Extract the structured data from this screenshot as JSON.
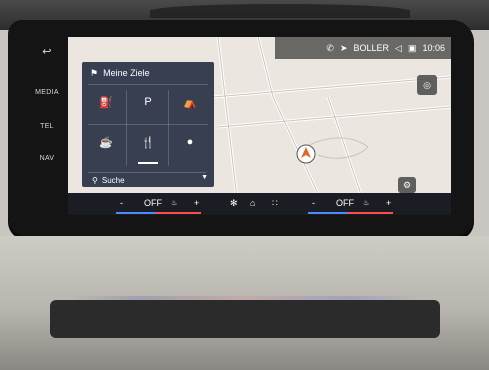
{
  "side_buttons": {
    "media": "MEDIA",
    "tel": "TEL",
    "nav": "NAV"
  },
  "status": {
    "location": "BOLLER",
    "time": "10:06"
  },
  "ziele": {
    "title": "Meine Ziele",
    "search": "Suche",
    "tiles": [
      "fuel-pump-icon",
      "parking-icon",
      "picnic-icon",
      "coffee-icon",
      "restaurant-icon",
      "burger-icon"
    ]
  },
  "climate": {
    "left": {
      "minus": "-",
      "status": "OFF",
      "plus": "+"
    },
    "right": {
      "minus": "-",
      "status": "OFF",
      "plus": "+"
    }
  },
  "colors": {
    "panel": "#1e283c",
    "accent_blue": "#4a8cff",
    "accent_red": "#ff4a4a"
  }
}
